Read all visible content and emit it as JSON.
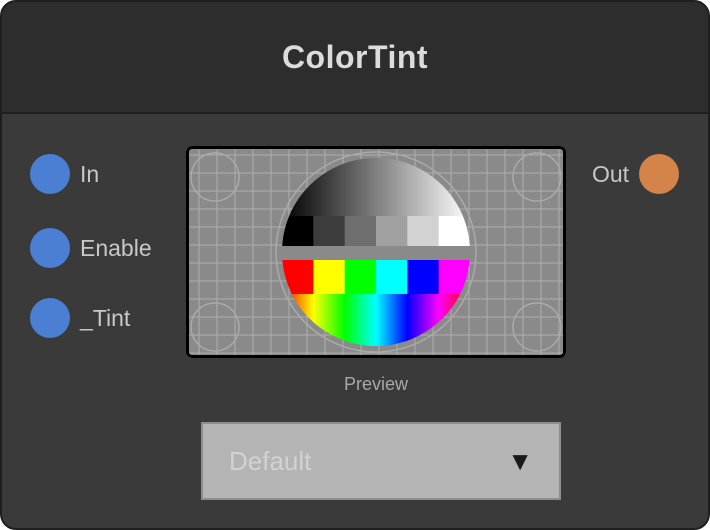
{
  "node": {
    "title": "ColorTint",
    "inputs": [
      {
        "label": "In",
        "color": "#4a7fd4"
      },
      {
        "label": "Enable",
        "color": "#4a7fd4"
      },
      {
        "label": "_Tint",
        "color": "#4a7fd4"
      }
    ],
    "outputs": [
      {
        "label": "Out",
        "color": "#d4844a"
      }
    ],
    "preview": {
      "caption": "Preview",
      "gray_bars": [
        "#000000",
        "#3c3c3c",
        "#6e6e6e",
        "#a0a0a0",
        "#d2d2d2",
        "#ffffff"
      ],
      "color_bars": [
        "#ff0000",
        "#ffff00",
        "#00ff00",
        "#00ffff",
        "#0000ff",
        "#ff00ff"
      ],
      "spectrum": [
        "#ff0000",
        "#ff8000",
        "#ffff00",
        "#80ff00",
        "#00ff00",
        "#00ff80",
        "#00ffff",
        "#0080ff",
        "#0000ff",
        "#8000ff",
        "#ff00ff",
        "#ff0080",
        "#ff0000"
      ]
    },
    "dropdown": {
      "value": "Default",
      "arrow_icon": "triangle-down-icon"
    }
  }
}
